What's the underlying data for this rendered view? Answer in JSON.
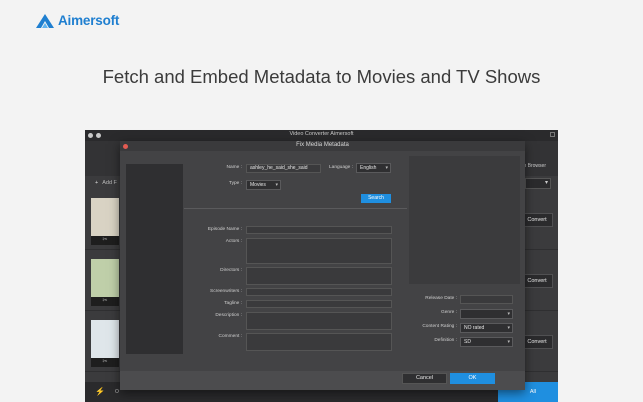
{
  "brand": {
    "name": "Aimersoft",
    "accent": "#1f7fd0"
  },
  "headline": "Fetch and Embed Metadata to Movies and TV Shows",
  "app": {
    "window_title": "Video Converter Aimersoft",
    "add_files_label": "Add F",
    "browser_label": "n Browser",
    "convert_label": "Convert",
    "output_label": "O",
    "convert_all_label": "All"
  },
  "dialog": {
    "title": "Fix Media Metadata",
    "name_label": "Name :",
    "name_value": "ashley_he_said_she_said",
    "language_label": "Language :",
    "language_value": "English",
    "type_label": "Type :",
    "type_value": "Movies",
    "search_label": "Search",
    "episode_name_label": "Episode Name :",
    "actors_label": "Actors :",
    "directors_label": "Directors :",
    "screenwriters_label": "Screenwriters :",
    "tagline_label": "Tagline :",
    "description_label": "Description :",
    "comment_label": "Comment :",
    "release_date_label": "Release Date :",
    "genre_label": "Genre :",
    "content_rating_label": "Content Rating :",
    "content_rating_value": "NO rated",
    "definition_label": "Definition :",
    "definition_value": "SD",
    "cancel_label": "Cancel",
    "ok_label": "OK",
    "accent": "#1f8fe0"
  }
}
